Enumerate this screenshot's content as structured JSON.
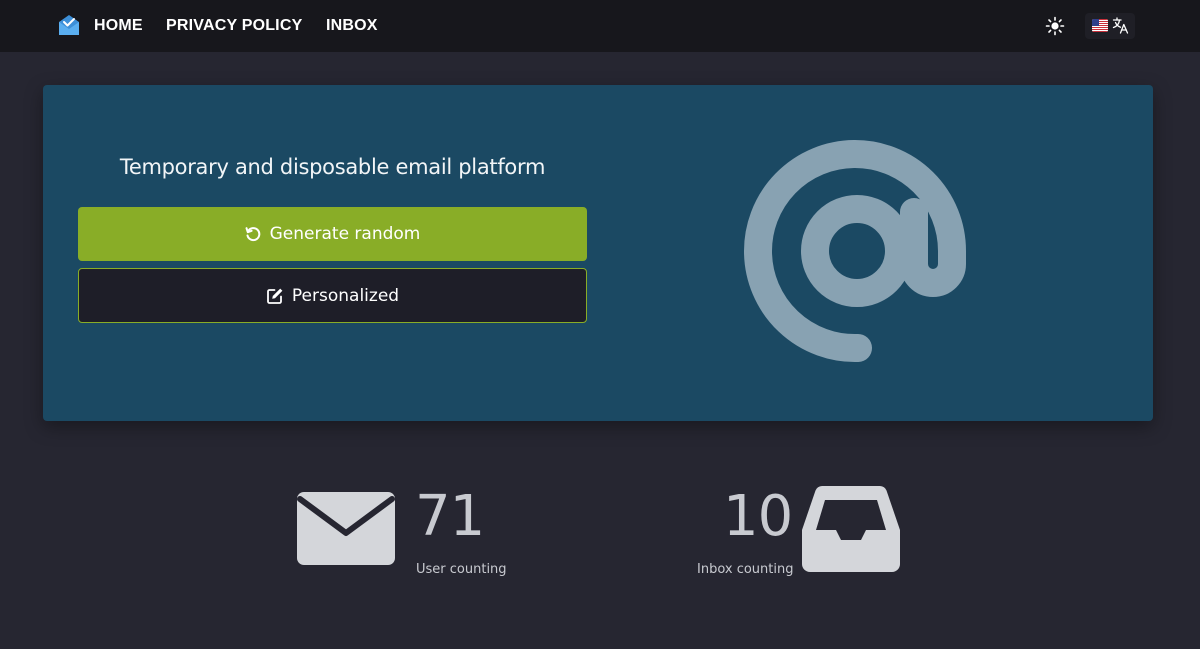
{
  "nav": {
    "links": {
      "home": "HOME",
      "privacy": "PRIVACY POLICY",
      "inbox": "INBOX"
    },
    "icons": {
      "logo": "mail-check-logo-icon",
      "theme": "sun-icon",
      "flag": "us-flag-icon",
      "translate": "translate-icon"
    }
  },
  "hero": {
    "title": "Temporary and disposable email platform",
    "generate_label": "Generate random",
    "personalized_label": "Personalized",
    "icons": {
      "generate": "rotate-left-icon",
      "personalized": "edit-icon",
      "illustration": "at-sign-icon"
    }
  },
  "stats": {
    "users": {
      "value": "71",
      "label": "User counting",
      "icon": "envelope-icon"
    },
    "inboxes": {
      "value": "10",
      "label": "Inbox counting",
      "icon": "inbox-tray-icon"
    }
  },
  "colors": {
    "navbar": "#17171c",
    "background": "#262631",
    "hero": "#1b4963",
    "accent_green": "#89ad27",
    "icon_gray": "#d4d6da"
  }
}
